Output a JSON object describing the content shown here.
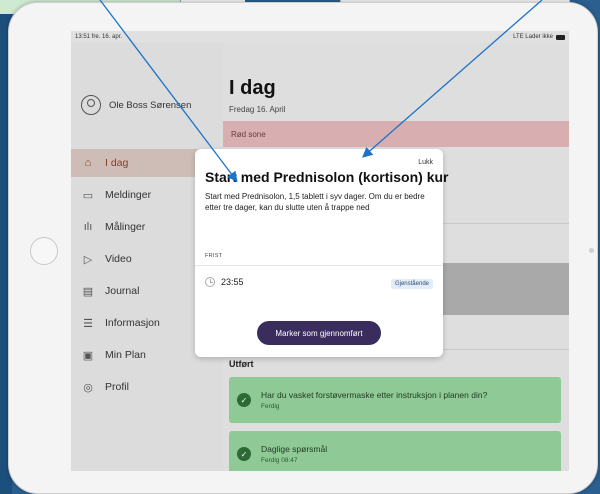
{
  "statusbar": {
    "time": "13:51  fre. 16. apr.",
    "network": "LTE Lader ikke"
  },
  "profile": {
    "name": "Ole Boss Sørensen"
  },
  "sidebar": {
    "items": [
      {
        "label": "I dag",
        "icon": "home-icon"
      },
      {
        "label": "Meldinger",
        "icon": "messages-icon"
      },
      {
        "label": "Målinger",
        "icon": "chart-icon"
      },
      {
        "label": "Video",
        "icon": "video-icon"
      },
      {
        "label": "Journal",
        "icon": "journal-icon"
      },
      {
        "label": "Informasjon",
        "icon": "info-doc-icon"
      },
      {
        "label": "Min Plan",
        "icon": "plan-icon"
      },
      {
        "label": "Profil",
        "icon": "profile-icon"
      }
    ]
  },
  "main": {
    "title": "I dag",
    "date": "Fredag 16. April",
    "zone": "Rød sone",
    "done_section": "Utført",
    "done_items": [
      {
        "title": "Har du vasket forstøvermaske etter instruksjon i planen din?",
        "status": "Ferdig"
      },
      {
        "title": "Daglige spørsmål",
        "status": "Ferdig 08:47"
      }
    ]
  },
  "modal": {
    "close": "Lukk",
    "title": "Start med Prednisolon (kortison) kur",
    "body": "Start med Prednisolon, 1,5 tablett i syv dager. Om du er bedre etter  tre dager, kan du slutte uten å trappe ned",
    "deadline_label": "FRIST",
    "deadline_time": "23:55",
    "badge": "Gjenstående",
    "button": "Marker som gjennomført"
  },
  "colors": {
    "active_nav": "#cebdb7",
    "red_zone": "#d9aeb0",
    "done_card": "#8fc996",
    "primary_button": "#3a2d5e",
    "annotation_arrow": "#1e73c8"
  }
}
